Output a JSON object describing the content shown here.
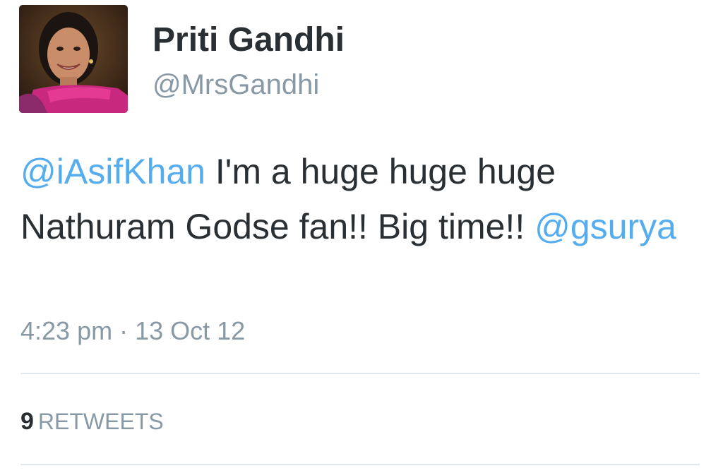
{
  "author": {
    "display_name": "Priti Gandhi",
    "handle": "@MrsGandhi",
    "avatar_icon": "profile-photo"
  },
  "tweet": {
    "reply_mention": "@iAsifKhan",
    "body": " I'm a huge huge huge Nathuram Godse fan!! Big time!! ",
    "trailing_mention": "@gsurya",
    "timestamp": "4:23 pm · 13 Oct 12"
  },
  "stats": {
    "retweet_count": "9",
    "retweet_label": "RETWEETS"
  },
  "colors": {
    "text": "#292f33",
    "muted": "#8899a6",
    "mention": "#55acee",
    "divider": "#e1e8ed"
  }
}
